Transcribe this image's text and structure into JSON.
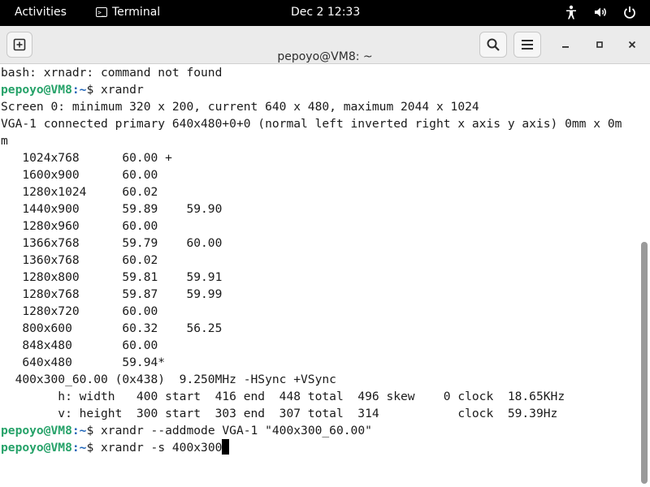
{
  "topbar": {
    "activities": "Activities",
    "app_name": "Terminal",
    "datetime": "Dec 2  12:33",
    "tray_icons": [
      "accessibility-icon",
      "volume-icon",
      "power-icon"
    ]
  },
  "window": {
    "title": "pepoyo@VM8: ~"
  },
  "terminal": {
    "lines": [
      {
        "type": "text",
        "text": "bash: xrnadr: command not found"
      },
      {
        "type": "prompt",
        "user": "pepoyo@VM8",
        "path": ":~",
        "cmd": "$ xrandr"
      },
      {
        "type": "text",
        "text": "Screen 0: minimum 320 x 200, current 640 x 480, maximum 2044 x 1024"
      },
      {
        "type": "text",
        "text": "VGA-1 connected primary 640x480+0+0 (normal left inverted right x axis y axis) 0mm x 0m"
      },
      {
        "type": "text",
        "text": "m"
      },
      {
        "type": "text",
        "text": "   1024x768      60.00 +"
      },
      {
        "type": "text",
        "text": "   1600x900      60.00"
      },
      {
        "type": "text",
        "text": "   1280x1024     60.02"
      },
      {
        "type": "text",
        "text": "   1440x900      59.89    59.90"
      },
      {
        "type": "text",
        "text": "   1280x960      60.00"
      },
      {
        "type": "text",
        "text": "   1366x768      59.79    60.00"
      },
      {
        "type": "text",
        "text": "   1360x768      60.02"
      },
      {
        "type": "text",
        "text": "   1280x800      59.81    59.91"
      },
      {
        "type": "text",
        "text": "   1280x768      59.87    59.99"
      },
      {
        "type": "text",
        "text": "   1280x720      60.00"
      },
      {
        "type": "text",
        "text": "   800x600       60.32    56.25"
      },
      {
        "type": "text",
        "text": "   848x480       60.00"
      },
      {
        "type": "text",
        "text": "   640x480       59.94*"
      },
      {
        "type": "text",
        "text": "  400x300_60.00 (0x438)  9.250MHz -HSync +VSync"
      },
      {
        "type": "text",
        "text": "        h: width   400 start  416 end  448 total  496 skew    0 clock  18.65KHz"
      },
      {
        "type": "text",
        "text": "        v: height  300 start  303 end  307 total  314           clock  59.39Hz"
      },
      {
        "type": "prompt",
        "user": "pepoyo@VM8",
        "path": ":~",
        "cmd": "$ xrandr --addmode VGA-1 \"400x300_60.00\""
      },
      {
        "type": "prompt",
        "user": "pepoyo@VM8",
        "path": ":~",
        "cmd": "$ xrandr -s 400x300",
        "cursor": true
      }
    ]
  },
  "colors": {
    "prompt_user": "#26a269",
    "prompt_path": "#1c63b8",
    "topbar_bg": "#000000",
    "headerbar_bg": "#ebebeb"
  }
}
